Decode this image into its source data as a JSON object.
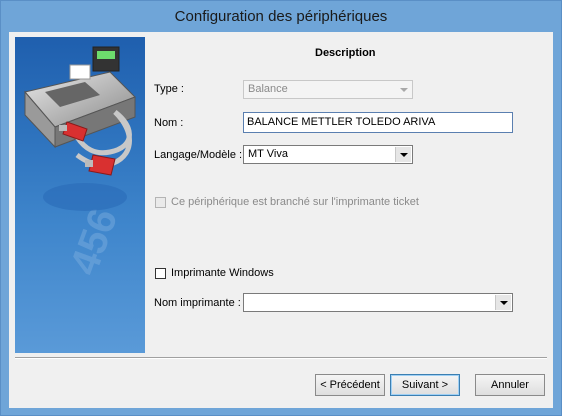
{
  "window": {
    "title": "Configuration des périphériques"
  },
  "section": {
    "title": "Description"
  },
  "type_field": {
    "label": "Type :",
    "value": "Balance"
  },
  "nom_field": {
    "label": "Nom :",
    "value": "BALANCE METTLER TOLEDO ARIVA"
  },
  "langage_field": {
    "label": "Langage/Modèle :",
    "value": "MT Viva"
  },
  "ticket_checkbox": {
    "label": "Ce périphérique est branché sur l'imprimante ticket",
    "checked": false,
    "enabled": false
  },
  "windows_checkbox": {
    "label": "Imprimante Windows",
    "checked": false
  },
  "printer_field": {
    "label": "Nom imprimante :",
    "value": ""
  },
  "buttons": {
    "prev": {
      "label": "< Précédent"
    },
    "next": {
      "label": "Suivant >"
    },
    "cancel": {
      "label": "Annuler"
    }
  },
  "sidebar_art": {
    "digits": "456"
  }
}
